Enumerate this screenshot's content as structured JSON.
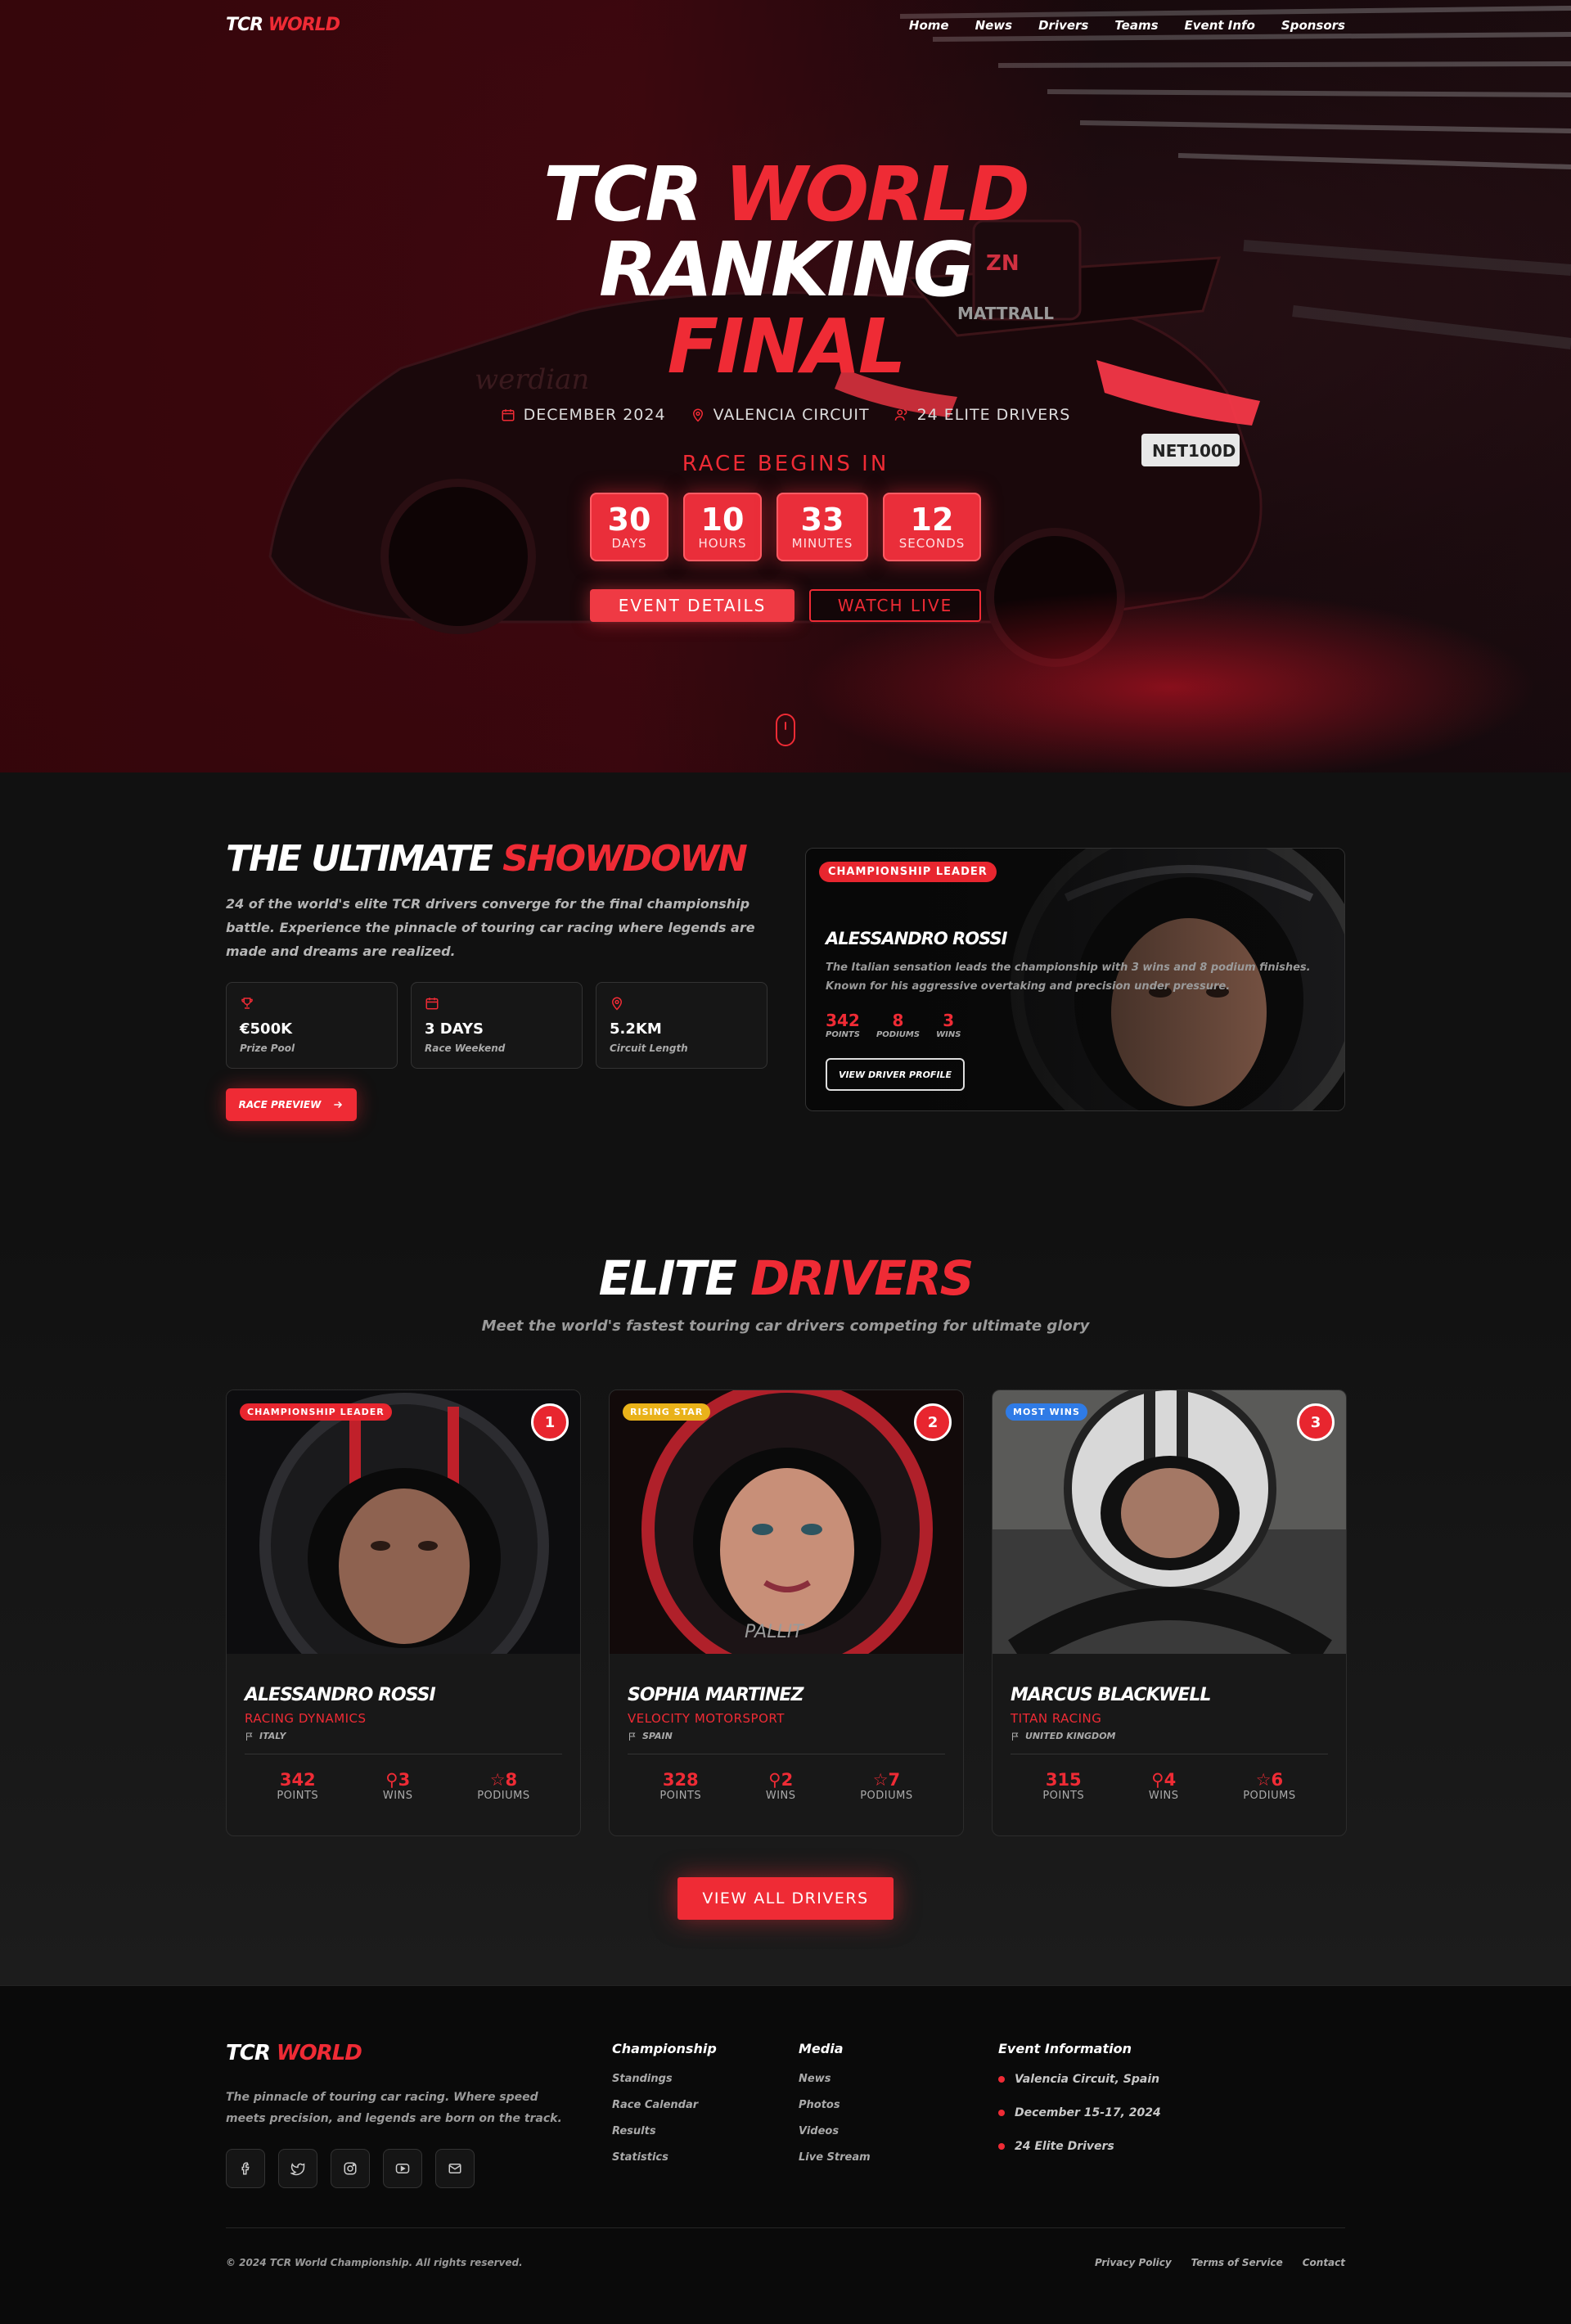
{
  "brand": {
    "part1": "TCR",
    "part2": "WORLD"
  },
  "nav": {
    "items": [
      "Home",
      "News",
      "Drivers",
      "Teams",
      "Event Info",
      "Sponsors"
    ]
  },
  "hero": {
    "title_line1_a": "TCR",
    "title_line1_b": "WORLD",
    "title_line2": "RANKING",
    "title_line3": "FINAL",
    "meta": [
      {
        "icon": "calendar-icon",
        "text": "DECEMBER 2024"
      },
      {
        "icon": "map-pin-icon",
        "text": "VALENCIA CIRCUIT"
      },
      {
        "icon": "users-icon",
        "text": "24 ELITE DRIVERS"
      }
    ],
    "countdown_label": "RACE BEGINS IN",
    "countdown": [
      {
        "value": "30",
        "label": "DAYS"
      },
      {
        "value": "10",
        "label": "HOURS"
      },
      {
        "value": "33",
        "label": "MINUTES"
      },
      {
        "value": "12",
        "label": "SECONDS"
      }
    ],
    "btn_primary": "EVENT DETAILS",
    "btn_secondary": "WATCH LIVE"
  },
  "showdown": {
    "title_a": "THE ULTIMATE",
    "title_b": "SHOWDOWN",
    "description": "24 of the world's elite TCR drivers converge for the final championship battle. Experience the pinnacle of touring car racing where legends are made and dreams are realized.",
    "stats": [
      {
        "icon": "trophy-icon",
        "value": "€500K",
        "label": "Prize Pool"
      },
      {
        "icon": "calendar-icon",
        "value": "3 DAYS",
        "label": "Race Weekend"
      },
      {
        "icon": "map-pin-icon",
        "value": "5.2KM",
        "label": "Circuit Length"
      }
    ],
    "cta": "RACE PREVIEW",
    "leader": {
      "badge": "CHAMPIONSHIP LEADER",
      "name": "ALESSANDRO ROSSI",
      "description": "The Italian sensation leads the championship with 3 wins and 8 podium finishes. Known for his aggressive overtaking and precision under pressure.",
      "stats": [
        {
          "value": "342",
          "label": "POINTS"
        },
        {
          "value": "8",
          "label": "PODIUMS"
        },
        {
          "value": "3",
          "label": "WINS"
        }
      ],
      "button": "VIEW DRIVER PROFILE"
    }
  },
  "elite": {
    "title_a": "ELITE",
    "title_b": "DRIVERS",
    "subtitle": "Meet the world's fastest touring car drivers competing for ultimate glory",
    "drivers": [
      {
        "badge": "CHAMPIONSHIP LEADER",
        "badge_color": "#e8262f",
        "rank": "1",
        "name": "ALESSANDRO ROSSI",
        "team": "RACING DYNAMICS",
        "country": "ITALY",
        "points": "342",
        "wins": "3",
        "podiums": "8",
        "points_label": "POINTS",
        "wins_label": "WINS",
        "podiums_label": "PODIUMS"
      },
      {
        "badge": "RISING STAR",
        "badge_color": "#e9b21a",
        "rank": "2",
        "name": "SOPHIA MARTINEZ",
        "team": "VELOCITY MOTORSPORT",
        "country": "SPAIN",
        "points": "328",
        "wins": "2",
        "podiums": "7",
        "points_label": "POINTS",
        "wins_label": "WINS",
        "podiums_label": "PODIUMS"
      },
      {
        "badge": "MOST WINS",
        "badge_color": "#2f7be6",
        "rank": "3",
        "name": "MARCUS BLACKWELL",
        "team": "TITAN RACING",
        "country": "UNITED KINGDOM",
        "points": "315",
        "wins": "4",
        "podiums": "6",
        "points_label": "POINTS",
        "wins_label": "WINS",
        "podiums_label": "PODIUMS"
      }
    ],
    "cta": "VIEW ALL DRIVERS"
  },
  "footer": {
    "description": "The pinnacle of touring car racing. Where speed meets precision, and legends are born on the track.",
    "social": [
      "facebook-icon",
      "twitter-icon",
      "instagram-icon",
      "youtube-icon",
      "mail-icon"
    ],
    "col1": {
      "heading": "Championship",
      "items": [
        "Standings",
        "Race Calendar",
        "Results",
        "Statistics"
      ]
    },
    "col2": {
      "heading": "Media",
      "items": [
        "News",
        "Photos",
        "Videos",
        "Live Stream"
      ]
    },
    "col3": {
      "heading": "Event Information",
      "items": [
        "Valencia Circuit, Spain",
        "December 15-17, 2024",
        "24 Elite Drivers"
      ]
    },
    "copyright": "© 2024 TCR World Championship. All rights reserved.",
    "legal": [
      "Privacy Policy",
      "Terms of Service",
      "Contact"
    ]
  },
  "colors": {
    "accent": "#ef2b35",
    "background": "#111111",
    "footer": "#0a0a0a"
  }
}
